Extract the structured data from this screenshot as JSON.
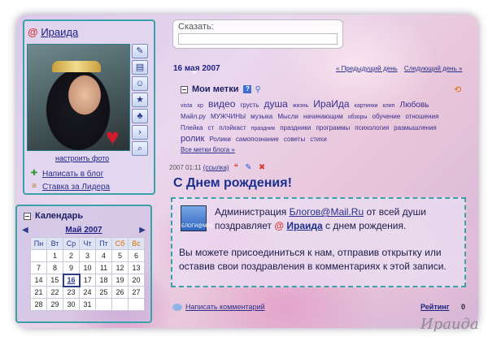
{
  "user": {
    "at_symbol": "@",
    "name": "Ираида",
    "setup_photo": "настроить фото"
  },
  "tools": [
    "✎",
    "▤",
    "☺",
    "★",
    "♣",
    "›",
    "⌕"
  ],
  "side_links": [
    {
      "label": "Написать в блог",
      "icon": "plus-icon"
    },
    {
      "label": "Ставка за Лидера",
      "icon": "stack-icon"
    }
  ],
  "calendar": {
    "title": "Календарь",
    "month": "Май 2007",
    "weekdays": [
      "Пн",
      "Вт",
      "Ср",
      "Чт",
      "Пт",
      "Сб",
      "Вс"
    ],
    "weeks": [
      [
        "",
        "1",
        "2",
        "3",
        "4",
        "5",
        "6"
      ],
      [
        "7",
        "8",
        "9",
        "10",
        "11",
        "12",
        "13"
      ],
      [
        "14",
        "15",
        "16",
        "17",
        "18",
        "19",
        "20"
      ],
      [
        "21",
        "22",
        "23",
        "24",
        "25",
        "26",
        "27"
      ],
      [
        "28",
        "29",
        "30",
        "31",
        "",
        "",
        ""
      ]
    ],
    "today": "16"
  },
  "say": {
    "label": "Сказать:",
    "value": ""
  },
  "post_date": "16 мая 2007",
  "day_nav": {
    "prev": "« Предыдущий день",
    "next": "Следующий день »"
  },
  "tags": {
    "title": "Мои метки",
    "items": [
      {
        "t": "vista",
        "w": 1
      },
      {
        "t": "xp",
        "w": 1
      },
      {
        "t": "видео",
        "w": 4
      },
      {
        "t": "грусть",
        "w": 2
      },
      {
        "t": "душа",
        "w": 4
      },
      {
        "t": "жизнь",
        "w": 1
      },
      {
        "t": "ИраИда",
        "w": 4
      },
      {
        "t": "картинки",
        "w": 1
      },
      {
        "t": "клип",
        "w": 1
      },
      {
        "t": "Любовь",
        "w": 3
      },
      {
        "t": "Майл.ру",
        "w": 2
      },
      {
        "t": "МУЖЧИНЫ",
        "w": 2
      },
      {
        "t": "музыка",
        "w": 2
      },
      {
        "t": "Мысли",
        "w": 2
      },
      {
        "t": "начинающим",
        "w": 2
      },
      {
        "t": "обзоры",
        "w": 1
      },
      {
        "t": "обучение",
        "w": 2
      },
      {
        "t": "отношения",
        "w": 2
      },
      {
        "t": "Плейка",
        "w": 2
      },
      {
        "t": "ст",
        "w": 2
      },
      {
        "t": "плэйкаст",
        "w": 2
      },
      {
        "t": "праздник",
        "w": 1
      },
      {
        "t": "праздники",
        "w": 2
      },
      {
        "t": "программы",
        "w": 2
      },
      {
        "t": "психология",
        "w": 2
      },
      {
        "t": "размышления",
        "w": 2
      },
      {
        "t": "ролик",
        "w": 5
      },
      {
        "t": "Ролики",
        "w": 2
      },
      {
        "t": "самопознание",
        "w": 2
      },
      {
        "t": "советы",
        "w": 2
      },
      {
        "t": "стихи",
        "w": 2
      }
    ],
    "all_link": "Все метки блога »"
  },
  "post": {
    "time": "2007 01:11",
    "link_label": "(ссылка)",
    "title": "С Днем рождения!",
    "line_prefix": "Администрация",
    "line_link": "Блогов@Mail.Ru",
    "line_rest": "от всей души поздравляет",
    "line_at": "@",
    "line_nick": "Ираида",
    "line_end": "с днем рождения.",
    "paragraph": "Вы можете присоединиться к нам, отправив открытку или оставив свои поздравления в комментариях к этой записи.",
    "icon_caption": "БЛОГИ@MAIL.RU"
  },
  "comments_label": "Написать комментарий",
  "rating": {
    "label": "Рейтинг",
    "value": "0"
  },
  "signature": "Ираида",
  "colors": {
    "accent": "#3aa2a8",
    "link": "#2a2f8a",
    "at_symbol": "#d23c3c"
  }
}
